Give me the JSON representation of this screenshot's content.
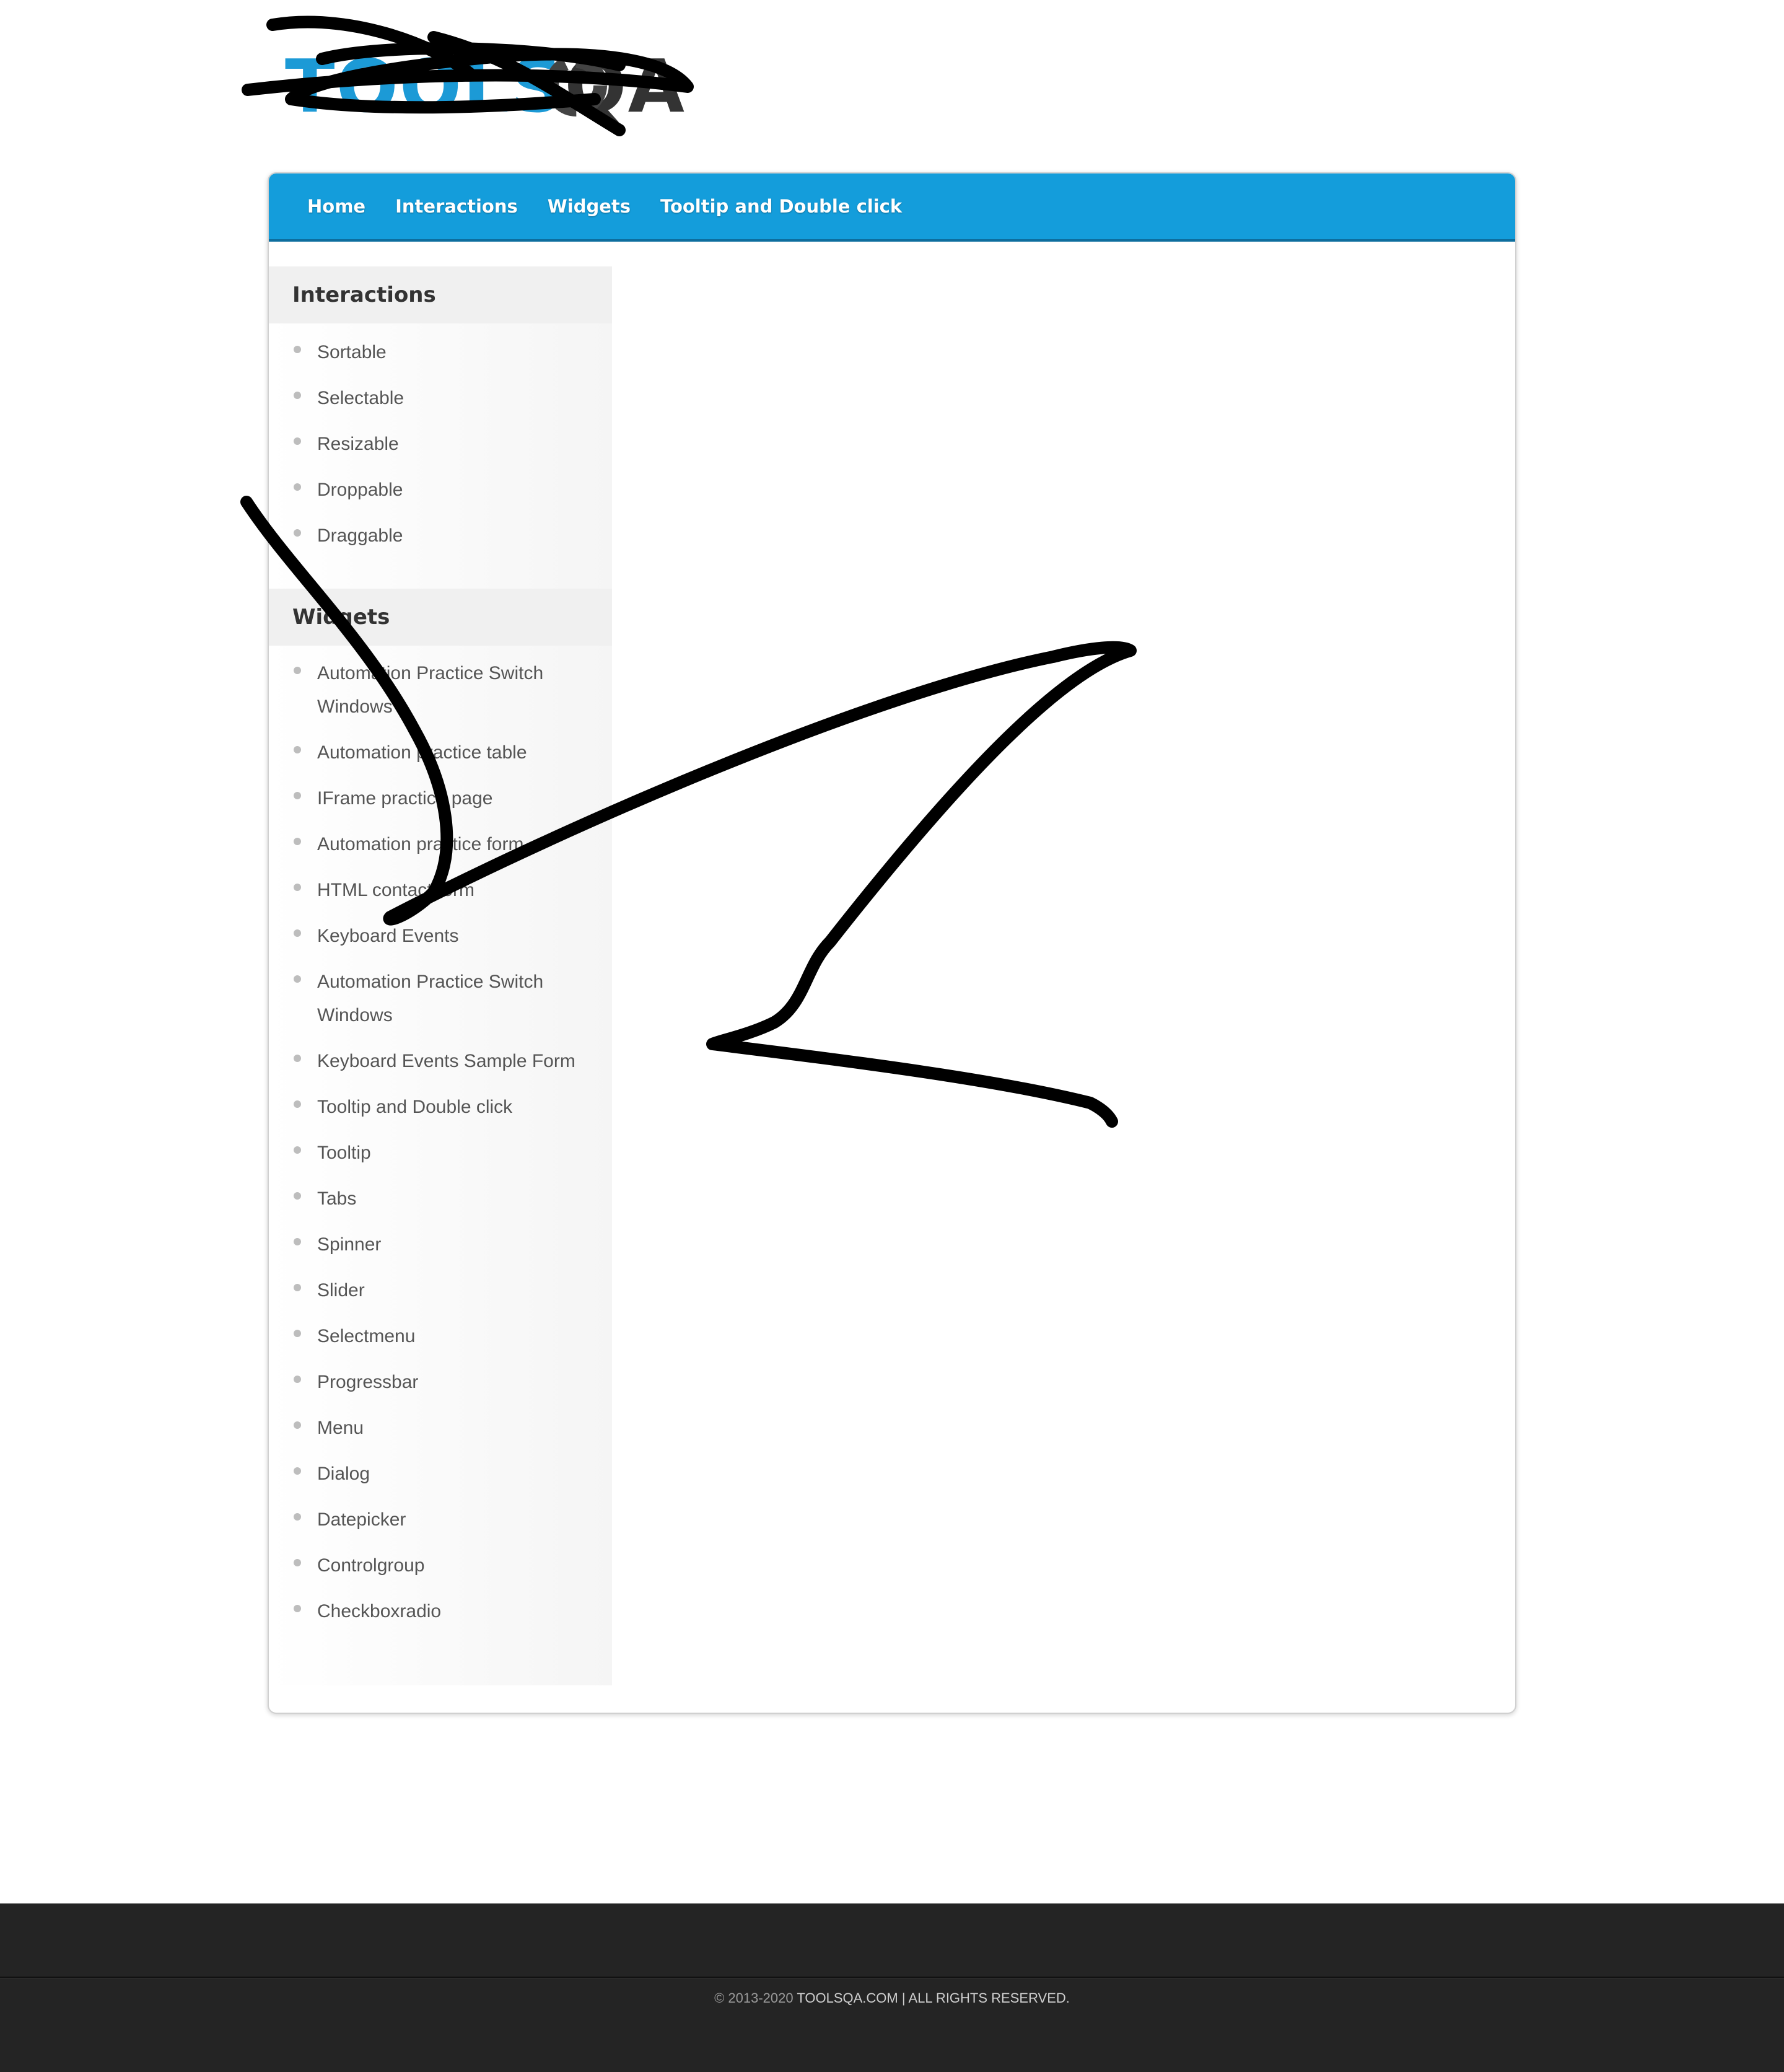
{
  "logo": {
    "brand": "TOOLS",
    "brand_suffix": "QA"
  },
  "topnav": [
    "Home",
    "Interactions",
    "Widgets",
    "Tooltip and Double click"
  ],
  "sidebar": {
    "interactions_title": "Interactions",
    "interactions": [
      "Sortable",
      "Selectable",
      "Resizable",
      "Droppable",
      "Draggable"
    ],
    "widgets_title": "Widgets",
    "widgets": [
      "Automation Practice Switch Windows",
      "Automation practice table",
      "IFrame practice page",
      "Automation practice form",
      "HTML contact form",
      "Keyboard Events",
      "Automation Practice Switch Windows",
      "Keyboard Events Sample Form",
      "Tooltip and Double click",
      "Tooltip",
      "Tabs",
      "Spinner",
      "Slider",
      "Selectmenu",
      "Progressbar",
      "Menu",
      "Dialog",
      "Datepicker",
      "Controlgroup",
      "Checkboxradio"
    ]
  },
  "footer": {
    "copyright": "© 2013-2020",
    "site": "TOOLSQA.COM",
    "rights": "| ALL RIGHTS RESERVED."
  }
}
